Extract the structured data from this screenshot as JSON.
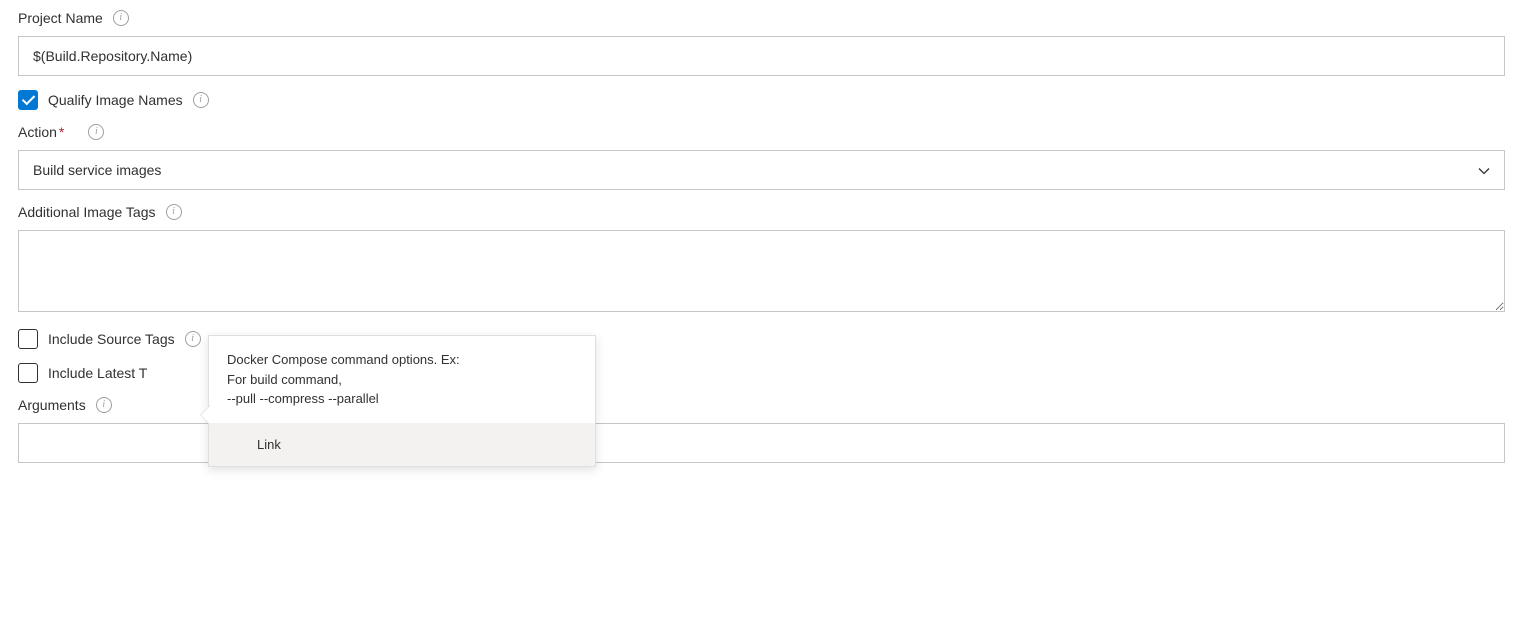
{
  "projectName": {
    "label": "Project Name",
    "value": "$(Build.Repository.Name)"
  },
  "qualifyImageNames": {
    "label": "Qualify Image Names",
    "checked": true
  },
  "action": {
    "label": "Action",
    "required": "*",
    "value": "Build service images"
  },
  "additionalImageTags": {
    "label": "Additional Image Tags",
    "value": ""
  },
  "includeSourceTags": {
    "label": "Include Source Tags",
    "checked": false
  },
  "includeLatestTag": {
    "label": "Include Latest T",
    "checked": false
  },
  "arguments": {
    "label": "Arguments",
    "value": ""
  },
  "tooltip": {
    "line1": "Docker Compose command options. Ex:",
    "line2": "For build command,",
    "line3": "--pull --compress --parallel",
    "footer": "Link"
  }
}
